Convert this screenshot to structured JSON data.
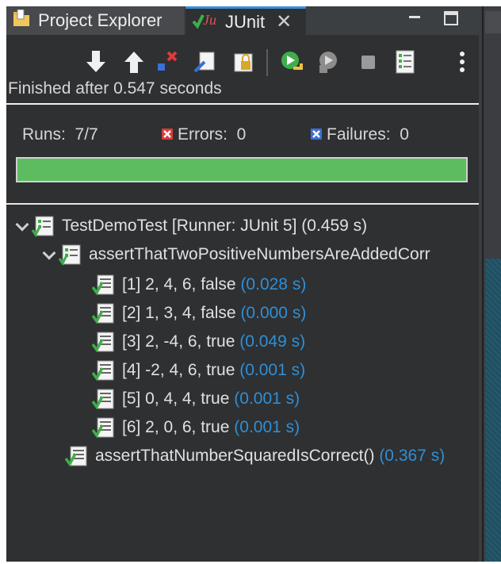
{
  "tabs": [
    {
      "label": "Project Explorer",
      "icon": "project-explorer-icon"
    },
    {
      "label": "JUnit",
      "icon": "junit-icon",
      "close": "✕",
      "active": true
    }
  ],
  "toolbar_icons": [
    "next-failure-icon",
    "previous-failure-icon",
    "show-failures-only-icon",
    "scroll-lock-icon",
    "show-skipped-icon",
    "rerun-icon",
    "rerun-failed-first-icon",
    "stop-icon",
    "test-run-history-icon",
    "view-menu-icon"
  ],
  "status": "Finished after 0.547 seconds",
  "counters": {
    "runs_label": "Runs:",
    "runs_value": "7/7",
    "errors_label": "Errors:",
    "errors_value": "0",
    "failures_label": "Failures:",
    "failures_value": "0"
  },
  "progress": 1.0,
  "colors": {
    "success": "#5cbc5f",
    "duration": "#2f8fd6",
    "error": "#d93a3a",
    "failure": "#3a6fd6"
  },
  "tree": {
    "root": {
      "name": "TestDemoTest [Runner: JUnit 5]",
      "time": "(0.459 s)"
    },
    "group": {
      "name": "assertThatTwoPositiveNumbersAreAddedCorr"
    },
    "params": [
      {
        "name": "[1] 2, 4, 6, false",
        "time": "(0.028 s)"
      },
      {
        "name": "[2] 1, 3, 4, false",
        "time": "(0.000 s)"
      },
      {
        "name": "[3] 2, -4, 6, true",
        "time": "(0.049 s)"
      },
      {
        "name": "[4] -2, 4, 6, true",
        "time": "(0.001 s)"
      },
      {
        "name": "[5] 0, 4, 4, true",
        "time": "(0.001 s)"
      },
      {
        "name": "[6] 2, 0, 6, true",
        "time": "(0.001 s)"
      }
    ],
    "method": {
      "name": "assertThatNumberSquaredIsCorrect()",
      "time": "(0.367 s)"
    }
  }
}
